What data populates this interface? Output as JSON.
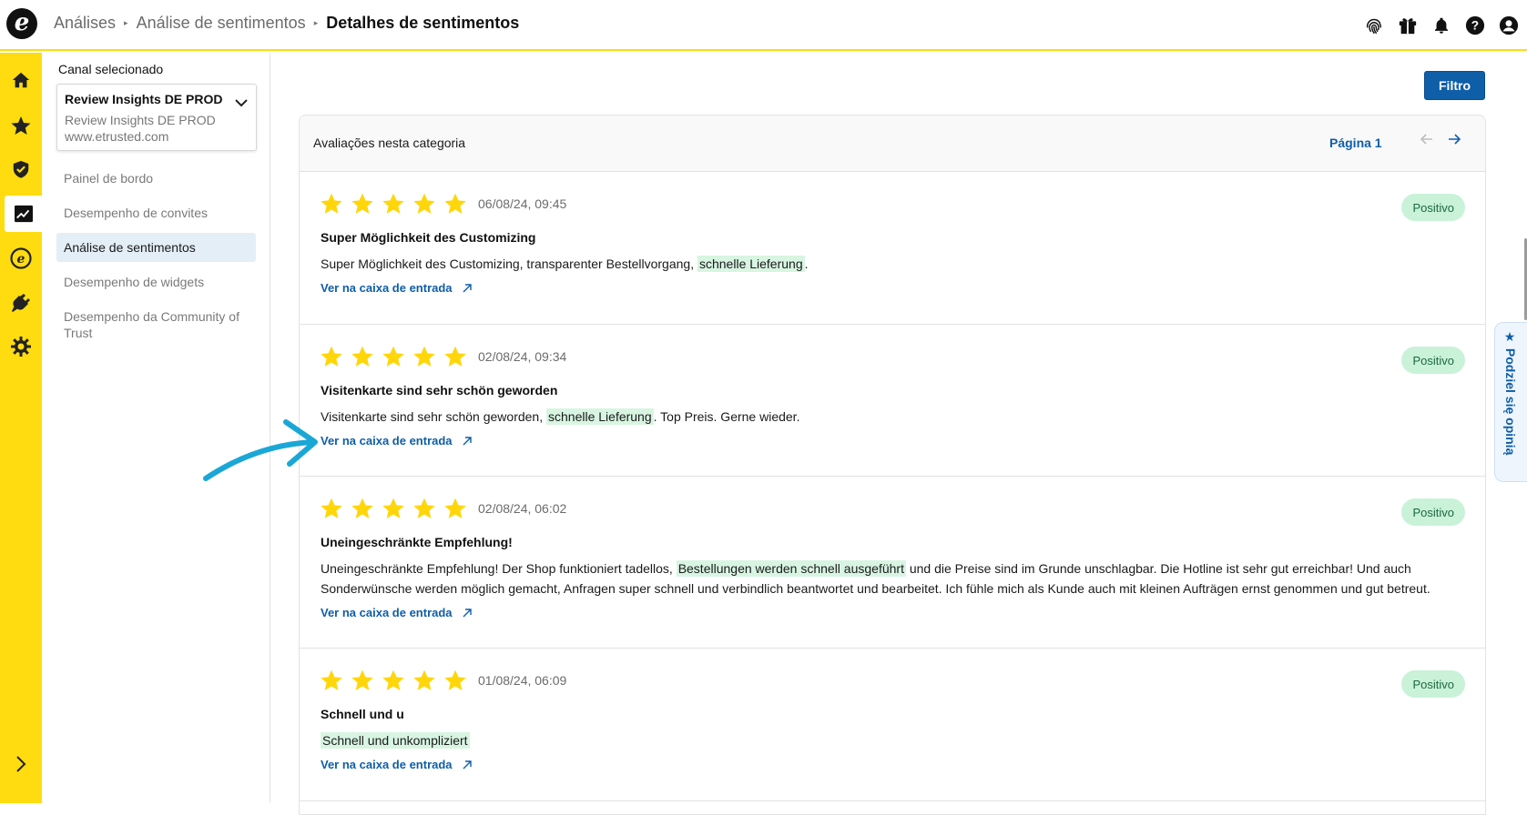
{
  "breadcrumb": {
    "items": [
      "Análises",
      "Análise de sentimentos"
    ],
    "current": "Detalhes de sentimentos"
  },
  "subnav": {
    "channel_label": "Canal selecionado",
    "channel_name": "Review Insights DE PROD",
    "channel_sub": "Review Insights DE PROD",
    "channel_url": "www.etrusted.com",
    "items": [
      {
        "label": "Painel de bordo"
      },
      {
        "label": "Desempenho de convites"
      },
      {
        "label": "Análise de sentimentos"
      },
      {
        "label": "Desempenho de widgets"
      },
      {
        "label": "Desempenho da Community of Trust"
      }
    ]
  },
  "main": {
    "filter_label": "Filtro",
    "panel_title": "Avaliações nesta categoria",
    "page_label": "Página 1",
    "link_label": "Ver na caixa de entrada",
    "reviews": [
      {
        "date": "06/08/24, 09:45",
        "badge": "Positivo",
        "title": "Super Möglichkeit des Customizing",
        "text_before": "Super Möglichkeit des Customizing, transparenter Bestellvorgang, ",
        "highlight": "schnelle Lieferung",
        "text_after": "."
      },
      {
        "date": "02/08/24, 09:34",
        "badge": "Positivo",
        "title": "Visitenkarte sind sehr schön geworden",
        "text_before": "Visitenkarte sind sehr schön geworden, ",
        "highlight": "schnelle Lieferung",
        "text_after": ". Top Preis. Gerne wieder."
      },
      {
        "date": "02/08/24, 06:02",
        "badge": "Positivo",
        "title": "Uneingeschränkte Empfehlung!",
        "text_before": "Uneingeschränkte Empfehlung! Der Shop funktioniert tadellos, ",
        "highlight": "Bestellungen werden schnell ausgeführt",
        "text_after": " und die Preise sind im Grunde unschlagbar. Die Hotline ist sehr gut erreichbar! Und auch Sonderwünsche werden möglich gemacht, Anfragen super schnell und verbindlich beantwortet und bearbeitet. Ich fühle mich als Kunde auch mit kleinen Aufträgen ernst genommen und gut betreut."
      },
      {
        "date": "01/08/24, 06:09",
        "badge": "Positivo",
        "title": "Schnell und u",
        "text_before": "",
        "highlight": "Schnell und unkompliziert",
        "text_after": ""
      }
    ]
  },
  "feedback_tab": "★ Podziel się opinią",
  "colors": {
    "accent_yellow": "#ffdc0f",
    "primary_blue": "#0f5ea8",
    "star_yellow": "#ffd60a",
    "positive_bg": "#c9f2d9",
    "annotation_arrow": "#1aa7d6"
  }
}
